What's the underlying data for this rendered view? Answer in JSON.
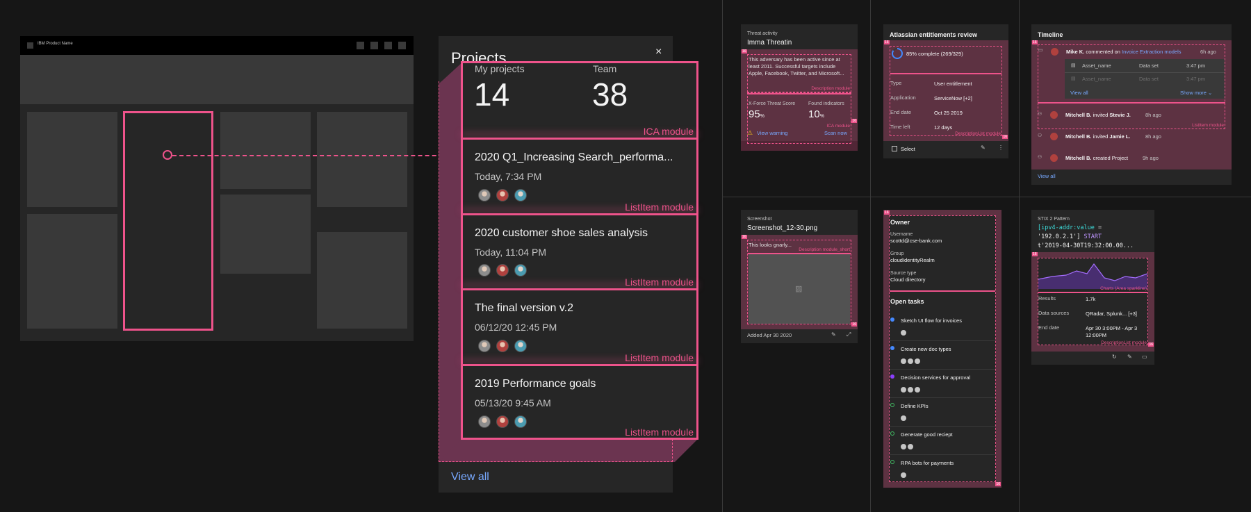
{
  "wireframe": {
    "product_name": "IBM Product Name"
  },
  "projects": {
    "title": "Projects",
    "close_icon": "×",
    "view_all": "View all",
    "ica": {
      "my_projects_label": "My projects",
      "my_projects_value": "14",
      "team_label": "Team",
      "team_value": "38",
      "module_label": "ICA module"
    },
    "items": [
      {
        "title": "2020 Q1_Increasing Search_performa...",
        "date": "Today, 7:34 PM",
        "module_label": "ListItem module"
      },
      {
        "title": "2020 customer shoe sales analysis",
        "date": "Today, 11:04 PM",
        "module_label": "ListItem module"
      },
      {
        "title": "The final version v.2",
        "date": "06/12/20 12:45 PM",
        "module_label": "ListItem module"
      },
      {
        "title": "2019 Performance goals",
        "date": "05/13/20 9:45 AM",
        "module_label": "ListItem module"
      }
    ]
  },
  "threat_card": {
    "eyebrow": "Threat activity",
    "title": "Imma Threatin",
    "description": "This adversary has been active since at least 2011. Successful targets include Apple, Facebook, Twitter, and Microsoft...",
    "desc_module": "Description module",
    "score_label": "X-Force Threat Score",
    "score_value": "95",
    "score_unit": "%",
    "found_label": "Found indicators",
    "found_value": "10",
    "found_unit": "%",
    "ica_module": "ICA module",
    "view_warning": "View warning",
    "scan_now": "Scan now",
    "badge": "16"
  },
  "atlassian_card": {
    "title": "Atlassian entitlements review",
    "progress_text": "85% complete (269/329)",
    "progress": 0.85,
    "rows": [
      {
        "label": "Type",
        "value": "User entitlement"
      },
      {
        "label": "Application",
        "value": "ServiceNow [+2]"
      },
      {
        "label": "End date",
        "value": "Oct 25 2019"
      },
      {
        "label": "Time left",
        "value": "12 days"
      }
    ],
    "module_label": "DescriptionList module",
    "select_label": "Select",
    "badge": "16"
  },
  "timeline_card": {
    "title": "Timeline",
    "first": {
      "user": "Mike K.",
      "action": "commented on",
      "link": "Invoice Extraction models",
      "time": "6h ago"
    },
    "assets": [
      {
        "name": "Asset_name",
        "type": "Data set",
        "time": "3:47 pm"
      },
      {
        "name": "Asset_name",
        "type": "Data set",
        "time": "3:47 pm"
      }
    ],
    "view_all_inner": "View all",
    "show_more": "Show more",
    "module_label": "ListItem module",
    "events": [
      {
        "user": "Mitchell B.",
        "action": "invited",
        "target": "Stevie J.",
        "time": "8h ago"
      },
      {
        "user": "Mitchell B.",
        "action": "invited",
        "target": "Jamie L.",
        "time": "8h ago"
      },
      {
        "user": "Mitchell B.",
        "action": "created",
        "target": "Project",
        "time": "9h ago"
      }
    ],
    "view_all": "View all",
    "badge": "16"
  },
  "screenshot_card": {
    "eyebrow": "Screenshot",
    "title": "Screenshot_12-30.png",
    "description": "This looks gnarly...",
    "module_label": "Description module_short",
    "added": "Added Apr 30 2020",
    "badge": "16"
  },
  "owner_card": {
    "owner_title": "Owner",
    "fields": [
      {
        "label": "Username",
        "value": "scottd@cse-bank.com"
      },
      {
        "label": "Group",
        "value": "cloudIdentityRealm"
      },
      {
        "label": "Source type",
        "value": "Cloud directory"
      }
    ],
    "tasks_title": "Open tasks",
    "tasks": [
      {
        "label": "Sketch UI flow for invoices",
        "avatars": 1
      },
      {
        "label": "Create new doc types",
        "avatars": 3
      },
      {
        "label": "Decision services for approval",
        "avatars": 3
      },
      {
        "label": "Define KPIs",
        "avatars": 1
      },
      {
        "label": "Generate good reciept",
        "avatars": 2
      },
      {
        "label": "RPA bots for payments",
        "avatars": 1
      }
    ],
    "badge": "16"
  },
  "stix_card": {
    "eyebrow": "STIX 2 Pattern",
    "code_line1_a": "[ipv4-addr:value",
    "code_line1_b": " =",
    "code_line2_a": "'192.0.2.1'] ",
    "code_line2_b": "START",
    "code_line3": "t'2019-04-30T19:32:00.00...",
    "chart_label": "Charts (Area sparkline)",
    "rows": [
      {
        "label": "Results",
        "value": "1.7k"
      },
      {
        "label": "Data sources",
        "value": "QRadar, Splunk... [+3]"
      },
      {
        "label": "End date",
        "value": "Apr 30 3:00PM - Apr 3 12:00PM"
      }
    ],
    "module_label": "DescriptionList module",
    "badge": "16"
  },
  "colors": {
    "accent": "#ee538b",
    "link": "#78a9ff",
    "bg": "#161616",
    "surface": "#262626"
  }
}
